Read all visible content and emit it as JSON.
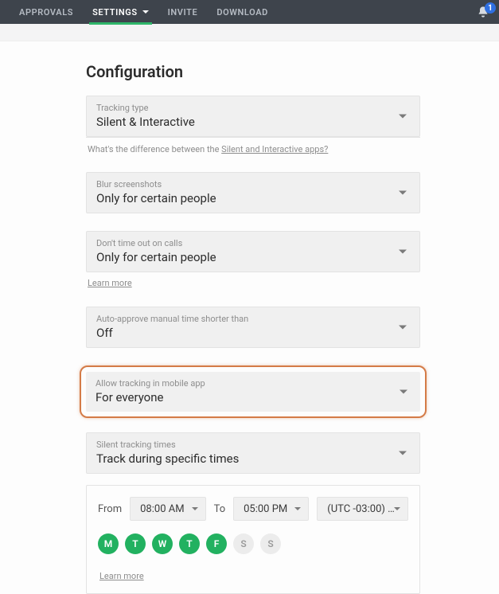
{
  "nav": {
    "tabs": {
      "approvals": "APPROVALS",
      "settings": "SETTINGS",
      "invite": "INVITE",
      "download": "DOWNLOAD"
    },
    "notification_count": "1"
  },
  "page_title": "Configuration",
  "tracking_type": {
    "label": "Tracking type",
    "value": "Silent & Interactive",
    "hint_prefix": "What's the difference between the ",
    "hint_link": "Silent and Interactive apps?"
  },
  "blur_screenshots": {
    "label": "Blur screenshots",
    "value": "Only for certain people"
  },
  "dont_timeout": {
    "label": "Don't time out on calls",
    "value": "Only for certain people",
    "learn_more": "Learn more"
  },
  "auto_approve": {
    "label": "Auto-approve manual time shorter than",
    "value": "Off"
  },
  "mobile_tracking": {
    "label": "Allow tracking in mobile app",
    "value": "For everyone"
  },
  "silent_times": {
    "label": "Silent tracking times",
    "value": "Track during specific times"
  },
  "time_period": {
    "from_label": "From",
    "from_value": "08:00 AM",
    "to_label": "To",
    "to_value": "05:00 PM",
    "tz_value": "(UTC -03:00) …",
    "days": [
      {
        "letter": "M",
        "on": true
      },
      {
        "letter": "T",
        "on": true
      },
      {
        "letter": "W",
        "on": true
      },
      {
        "letter": "T",
        "on": true
      },
      {
        "letter": "F",
        "on": true
      },
      {
        "letter": "S",
        "on": false
      },
      {
        "letter": "S",
        "on": false
      }
    ],
    "learn_more": "Learn more"
  }
}
